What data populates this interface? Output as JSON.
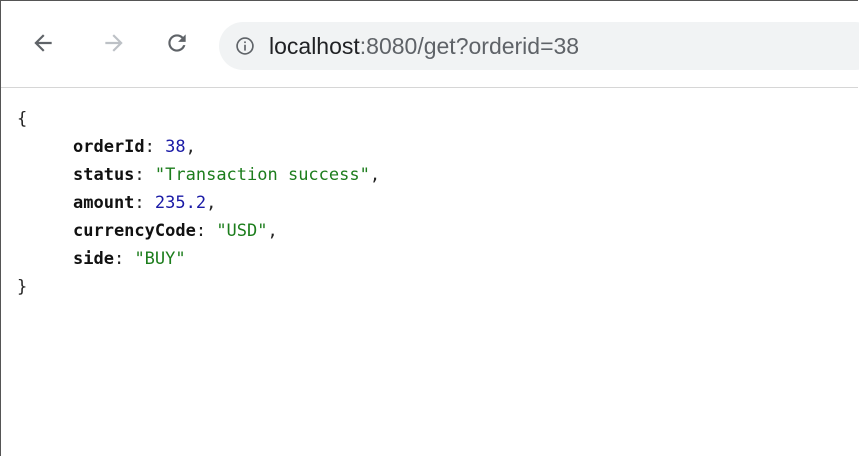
{
  "browser": {
    "url_host": "localhost",
    "url_rest": ":8080/get?orderid=38",
    "icons": {
      "back": "back-arrow-icon",
      "forward": "forward-arrow-icon",
      "reload": "reload-icon",
      "info": "info-icon"
    }
  },
  "json_view": {
    "open_brace": "{",
    "close_brace": "}",
    "colon": ": ",
    "comma": ",",
    "fields": [
      {
        "key": "orderId",
        "value": "38",
        "type": "number"
      },
      {
        "key": "status",
        "value": "\"Transaction success\"",
        "type": "string"
      },
      {
        "key": "amount",
        "value": "235.2",
        "type": "number"
      },
      {
        "key": "currencyCode",
        "value": "\"USD\"",
        "type": "string"
      },
      {
        "key": "side",
        "value": "\"BUY\"",
        "type": "string"
      }
    ]
  },
  "colors": {
    "number": "#1a1aa6",
    "string": "#1c7d1c",
    "omnibox_bg": "#f1f3f4"
  }
}
